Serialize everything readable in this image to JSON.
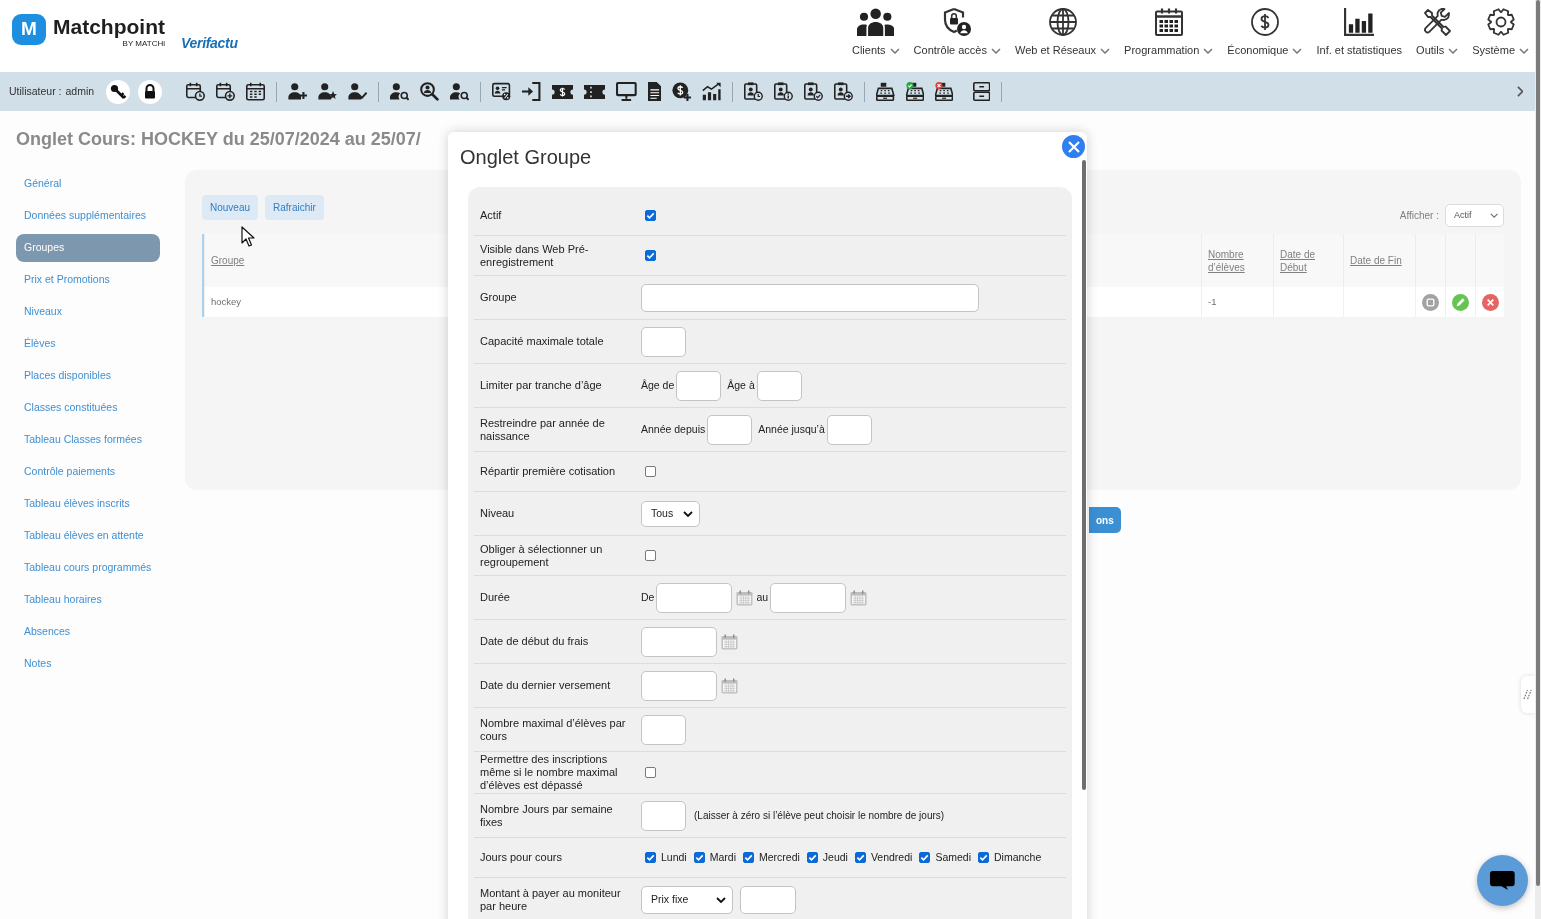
{
  "header": {
    "brand": {
      "mark": "M",
      "name": "Matchpoint",
      "tagline": "BY MATCHi"
    },
    "partner_logo": "Verifactu",
    "nav": [
      {
        "label": "Clients",
        "dropdown": true
      },
      {
        "label": "Contrôle accès",
        "dropdown": true
      },
      {
        "label": "Web et Réseaux",
        "dropdown": true
      },
      {
        "label": "Programmation",
        "dropdown": true
      },
      {
        "label": "Économique",
        "dropdown": true
      },
      {
        "label": "Inf. et statistiques",
        "dropdown": false
      },
      {
        "label": "Outils",
        "dropdown": true
      },
      {
        "label": "Système",
        "dropdown": true
      }
    ]
  },
  "toolbar": {
    "user_label": "Utilisateur :",
    "user": "admin"
  },
  "page": {
    "title": "Onglet Cours: HOCKEY du 25/07/2024 au 25/07/",
    "sidebar": {
      "items": [
        {
          "label": "Général",
          "selected": false
        },
        {
          "label": "Données supplémentaires",
          "selected": false
        },
        {
          "label": "Groupes",
          "selected": true
        },
        {
          "label": "Prix et Promotions",
          "selected": false
        },
        {
          "label": "Niveaux",
          "selected": false
        },
        {
          "label": "Élèves",
          "selected": false
        },
        {
          "label": "Places disponibles",
          "selected": false
        },
        {
          "label": "Classes constituées",
          "selected": false
        },
        {
          "label": "Tableau Classes formées",
          "selected": false
        },
        {
          "label": "Contrôle paiements",
          "selected": false
        },
        {
          "label": "Tableau élèves inscrits",
          "selected": false
        },
        {
          "label": "Tableau élèves en attente",
          "selected": false
        },
        {
          "label": "Tableau cours programmés",
          "selected": false
        },
        {
          "label": "Tableau horaires",
          "selected": false
        },
        {
          "label": "Absences",
          "selected": false
        },
        {
          "label": "Notes",
          "selected": false
        }
      ]
    },
    "panel": {
      "buttons": [
        "Nouveau",
        "Rafraichir"
      ],
      "filter": {
        "label": "Afficher :",
        "value": "Actif"
      },
      "table": {
        "columns": [
          "Groupe",
          "Nombre d’élèves",
          "Date de Début",
          "Date de Fin"
        ],
        "rows": [
          {
            "group": "hockey",
            "students": "-1"
          }
        ]
      }
    },
    "action_button": "ons"
  },
  "modal": {
    "title": "Onglet Groupe",
    "fields": [
      {
        "kind": "checkbox",
        "label": "Actif",
        "checked": true
      },
      {
        "kind": "checkbox",
        "label": "Visible dans Web Pré-enregistrement",
        "checked": true
      },
      {
        "kind": "text",
        "label": "Groupe"
      },
      {
        "kind": "number",
        "label": "Capacité maximale totale"
      },
      {
        "kind": "range",
        "label": "Limiter par tranche d’âge",
        "inputs": [
          {
            "prefix": "Âge de"
          },
          {
            "prefix": "Âge à"
          }
        ]
      },
      {
        "kind": "range",
        "label": "Restreindre par année de naissance",
        "inputs": [
          {
            "prefix": "Année depuis"
          },
          {
            "prefix": "Année jusqu’à"
          }
        ]
      },
      {
        "kind": "checkbox",
        "label": "Répartir première cotisation",
        "checked": false
      },
      {
        "kind": "select",
        "label": "Niveau",
        "value": "Tous"
      },
      {
        "kind": "checkbox",
        "label": "Obliger à sélectionner un regroupement",
        "checked": false
      },
      {
        "kind": "date_range",
        "label": "Durée",
        "inputs": [
          {
            "prefix": "De"
          },
          {
            "prefix": "au"
          }
        ]
      },
      {
        "kind": "date",
        "label": "Date de début du frais"
      },
      {
        "kind": "date",
        "label": "Date du dernier versement"
      },
      {
        "kind": "number",
        "label": "Nombre maximal d’élèves par cours"
      },
      {
        "kind": "checkbox",
        "label": "Permettre des inscriptions même si le nombre maximal d’élèves est dépassé",
        "checked": false
      },
      {
        "kind": "number",
        "label": "Nombre Jours par semaine fixes",
        "hint": "(Laisser à zéro si l’élève peut choisir le nombre de jours)"
      },
      {
        "kind": "days",
        "label": "Jours pour cours",
        "options": [
          {
            "label": "Lundi",
            "checked": true
          },
          {
            "label": "Mardi",
            "checked": true
          },
          {
            "label": "Mercredi",
            "checked": true
          },
          {
            "label": "Jeudi",
            "checked": true
          },
          {
            "label": "Vendredi",
            "checked": true
          },
          {
            "label": "Samedi",
            "checked": true
          },
          {
            "label": "Dimanche",
            "checked": true
          }
        ]
      },
      {
        "kind": "select_number",
        "label": "Montant à payer au moniteur par heure",
        "value": "Prix fixe"
      }
    ]
  }
}
